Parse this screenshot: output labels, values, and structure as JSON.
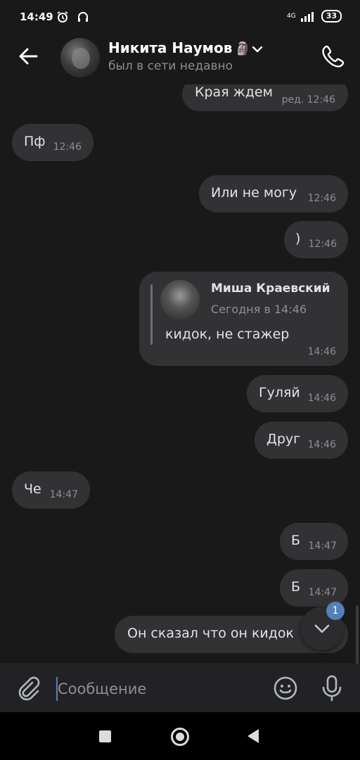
{
  "status_bar": {
    "time": "14:49",
    "battery": "33",
    "network": "4G"
  },
  "header": {
    "name": "Никита Наумов",
    "name_emoji": "🗿",
    "status": "был в сети недавно"
  },
  "messages": [
    {
      "text": "Края ждем",
      "time": "ред. 12:46",
      "side": "out"
    },
    {
      "text": "Пф",
      "time": "12:46",
      "side": "in"
    },
    {
      "text": "Или не могу",
      "time": "12:46",
      "side": "out"
    },
    {
      "text": ")",
      "time": "12:46",
      "side": "out"
    },
    {
      "reply_name": "Миша Краевский",
      "reply_date": "Сегодня в 14:46",
      "text": "кидок, не стажер",
      "time": "14:46",
      "side": "out"
    },
    {
      "text": "Гуляй",
      "time": "14:46",
      "side": "out"
    },
    {
      "text": "Друг",
      "time": "14:46",
      "side": "out"
    },
    {
      "text": "Че",
      "time": "14:47",
      "side": "in"
    },
    {
      "text": "Б",
      "time": "14:47",
      "side": "out"
    },
    {
      "text": "Б",
      "time": "14:47",
      "side": "out"
    },
    {
      "text": "Он сказал что он кидок",
      "side": "out"
    }
  ],
  "scroll_down": {
    "unread_count": "1"
  },
  "composer": {
    "placeholder": "Сообщение"
  },
  "colors": {
    "background": "#19191a",
    "bubble": "#323234",
    "accent": "#5181b8",
    "meta_text": "#8e8e93"
  },
  "icons": [
    "back-arrow-icon",
    "chevron-down-icon",
    "phone-icon",
    "paperclip-icon",
    "emoji-icon",
    "microphone-icon",
    "chevron-down-icon"
  ]
}
